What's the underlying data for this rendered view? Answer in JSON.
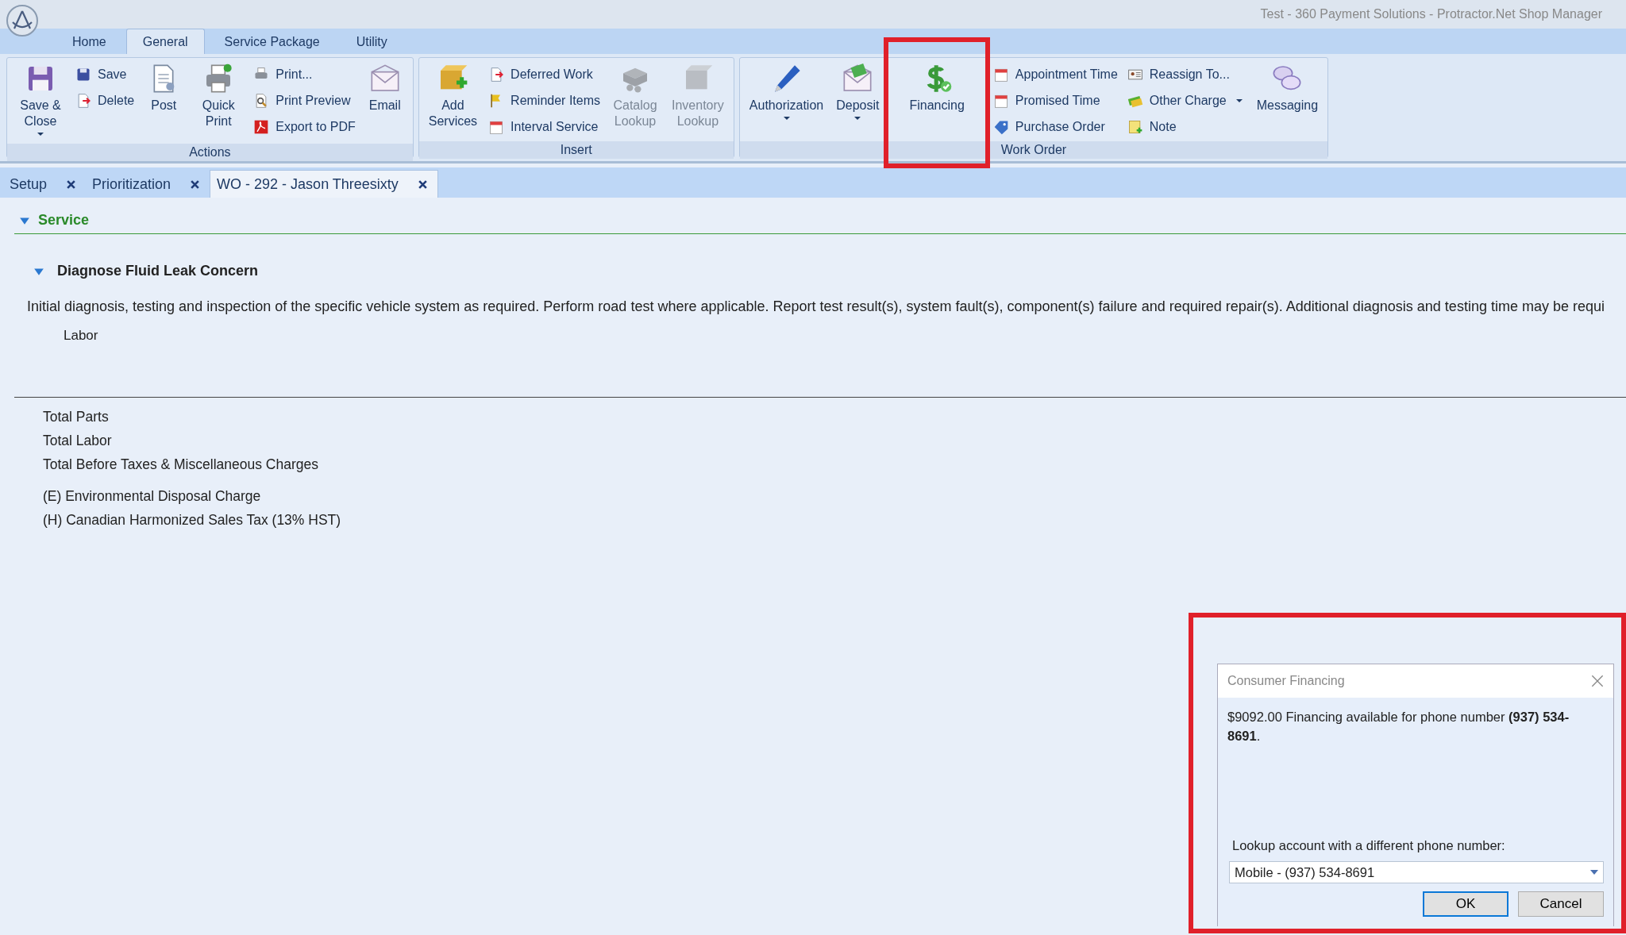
{
  "window": {
    "title": "Test - 360 Payment Solutions - Protractor.Net Shop Manager"
  },
  "ribbon_tabs": [
    {
      "label": "Home",
      "selected": false
    },
    {
      "label": "General",
      "selected": true
    },
    {
      "label": "Service Package",
      "selected": false
    },
    {
      "label": "Utility",
      "selected": false
    }
  ],
  "ribbon": {
    "groups": [
      {
        "label": "Actions",
        "columns": [
          {
            "kind": "large",
            "label": "Save & Close",
            "dropdown": true,
            "disabled": false
          },
          {
            "kind": "stack",
            "items": [
              {
                "label": "Save",
                "dropdown": false
              },
              {
                "label": "Delete",
                "dropdown": false
              }
            ]
          },
          {
            "kind": "large",
            "label": "Post",
            "dropdown": false,
            "disabled": false
          },
          {
            "kind": "large",
            "label": "Quick Print",
            "dropdown": false,
            "disabled": false
          },
          {
            "kind": "stack",
            "items": [
              {
                "label": "Print...",
                "dropdown": false
              },
              {
                "label": "Print Preview",
                "dropdown": false
              },
              {
                "label": "Export to PDF",
                "dropdown": false
              }
            ]
          },
          {
            "kind": "large",
            "label": "Email",
            "dropdown": false,
            "disabled": false
          }
        ]
      },
      {
        "label": "Insert",
        "columns": [
          {
            "kind": "large",
            "label": "Add Services",
            "dropdown": false,
            "disabled": false
          },
          {
            "kind": "stack",
            "items": [
              {
                "label": "Deferred Work",
                "dropdown": false
              },
              {
                "label": "Reminder Items",
                "dropdown": false
              },
              {
                "label": "Interval Service",
                "dropdown": false
              }
            ]
          },
          {
            "kind": "large",
            "label": "Catalog Lookup",
            "dropdown": false,
            "disabled": true
          },
          {
            "kind": "large",
            "label": "Inventory Lookup",
            "dropdown": false,
            "disabled": true
          }
        ]
      },
      {
        "label": "Work Order",
        "columns": [
          {
            "kind": "large",
            "label": "Authorization",
            "dropdown": true,
            "disabled": false
          },
          {
            "kind": "large",
            "label": "Deposit",
            "dropdown": true,
            "disabled": false
          },
          {
            "kind": "large",
            "label": "Financing",
            "dropdown": false,
            "disabled": false,
            "highlighted": true
          },
          {
            "kind": "stack",
            "items": [
              {
                "label": "Appointment Time",
                "dropdown": false
              },
              {
                "label": "Promised Time",
                "dropdown": false
              },
              {
                "label": "Purchase Order",
                "dropdown": false
              }
            ]
          },
          {
            "kind": "stack",
            "items": [
              {
                "label": "Reassign To...",
                "dropdown": false
              },
              {
                "label": "Other Charge",
                "dropdown": true
              },
              {
                "label": "Note",
                "dropdown": false
              }
            ]
          },
          {
            "kind": "large",
            "label": "Messaging",
            "dropdown": false,
            "disabled": false
          }
        ]
      }
    ]
  },
  "document_tabs": [
    {
      "label": "Setup",
      "selected": false
    },
    {
      "label": "Prioritization",
      "selected": false
    },
    {
      "label": "WO - 292 - Jason Threesixty",
      "selected": true
    }
  ],
  "section": {
    "title": "Service",
    "expanded": true,
    "service": {
      "title": "Diagnose Fluid Leak Concern",
      "expanded": true,
      "description": "Initial diagnosis, testing and inspection of the specific vehicle system as required.  Perform road test where applicable.  Report test result(s), system fault(s), component(s) failure and required repair(s).  Additional diagnosis and testing time may be requi",
      "labor_label": "Labor"
    }
  },
  "total_groups": [
    {
      "items": [
        "Total Parts",
        "Total Labor",
        "Total Before Taxes & Miscellaneous Charges"
      ]
    },
    {
      "items": [
        "(E) Environmental Disposal Charge",
        "(H) Canadian Harmonized Sales Tax (13% HST)"
      ]
    }
  ],
  "dialog": {
    "title": "Consumer Financing",
    "message": "$9092.00 Financing available for phone number **(937) 534-8691**.",
    "lookup_label": "Lookup account with a different phone number:",
    "phone_select": {
      "value": "Mobile - (937) 534-8691"
    },
    "buttons": [
      {
        "label": "OK",
        "selected": true
      },
      {
        "label": "Cancel",
        "selected": false
      }
    ]
  }
}
